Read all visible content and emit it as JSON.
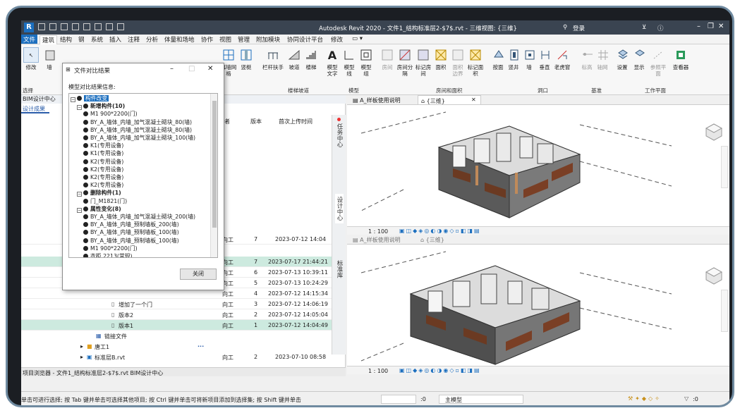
{
  "window": {
    "title": "Autodesk Revit 2020 - 文件1_结构标准层2-$7$.rvt - 三维视图: {三维}",
    "user": "登录",
    "search_icon": "binoculars-icon"
  },
  "menu": [
    "文件",
    "建筑",
    "结构",
    "钢",
    "系统",
    "插入",
    "注释",
    "分析",
    "体量和场地",
    "协作",
    "视图",
    "管理",
    "附加模块",
    "协同设计平台",
    "修改"
  ],
  "ribbon": {
    "tools": [
      "修改",
      "墙",
      "幕墙网格",
      "竖梃",
      "栏杆扶手",
      "坡道",
      "楼梯",
      "模型文字",
      "模型线",
      "模型组",
      "房间",
      "房间分隔",
      "标记房间",
      "面积",
      "面积边界",
      "标记面积",
      "按面",
      "竖井",
      "墙",
      "垂直",
      "老虎窗",
      "标高",
      "轴网",
      "设置",
      "显示",
      "参照平面",
      "查看器"
    ],
    "panels": [
      "选择",
      "楼梯坡道",
      "模型",
      "房间和面积",
      "洞口",
      "基准",
      "工作平面"
    ]
  },
  "left_panel": {
    "header": "BIM设计中心",
    "tab": "设计成果",
    "columns": [
      "作者",
      "版本",
      "首次上传时间"
    ],
    "rows": [
      {
        "name": "",
        "author": "向工",
        "version": "7",
        "time": "2023-07-12 14:04"
      },
      {
        "name": "",
        "author": "向工",
        "version": "7",
        "time": "2023-07-17 21:44:21"
      },
      {
        "name": "",
        "author": "向工",
        "version": "6",
        "time": "2023-07-13 10:39:11"
      },
      {
        "name": "",
        "author": "向工",
        "version": "5",
        "time": "2023-07-13 10:24:29"
      },
      {
        "name": "",
        "author": "向工",
        "version": "4",
        "time": "2023-07-12 14:15:34"
      },
      {
        "name": "增加了一个门",
        "author": "向工",
        "version": "3",
        "time": "2023-07-12 14:06:19"
      },
      {
        "name": "版本2",
        "author": "向工",
        "version": "2",
        "time": "2023-07-12 14:05:04"
      },
      {
        "name": "版本1",
        "author": "向工",
        "version": "1",
        "time": "2023-07-12 14:04:49"
      }
    ],
    "link_file": "链接文件",
    "folder": "唐工1",
    "file": "标准层B.rvt",
    "file_author": "向工",
    "file_version": "2",
    "file_time": "2023-07-10 08:58",
    "side_tabs": [
      "任务中心",
      "设计中心",
      "标准库"
    ],
    "browser_tabs": "项目浏览器 - 文件1_结构标准层2-$7$.rvt   BIM设计中心"
  },
  "dialog": {
    "title": "文件对比结果",
    "info_label": "模型对比结果信息:",
    "close_button": "关闭",
    "tree": [
      {
        "level": 0,
        "text": "构件改变",
        "kind": "root"
      },
      {
        "level": 1,
        "text": "新增构件(10)",
        "kind": "group"
      },
      {
        "level": 2,
        "text": "M1 900*2200(门)"
      },
      {
        "level": 2,
        "text": "BY_A_墙体_内墙_加气混凝土砌块_80(墙)"
      },
      {
        "level": 2,
        "text": "BY_A_墙体_内墙_加气混凝土砌块_80(墙)"
      },
      {
        "level": 2,
        "text": "BY_A_墙体_内墙_加气混凝土砌块_100(墙)"
      },
      {
        "level": 2,
        "text": "K1(专用设备)"
      },
      {
        "level": 2,
        "text": "K1(专用设备)"
      },
      {
        "level": 2,
        "text": "K2(专用设备)"
      },
      {
        "level": 2,
        "text": "K2(专用设备)"
      },
      {
        "level": 2,
        "text": "K2(专用设备)"
      },
      {
        "level": 2,
        "text": "K2(专用设备)"
      },
      {
        "level": 1,
        "text": "删除构件(1)",
        "kind": "group"
      },
      {
        "level": 2,
        "text": "门_M1821(门)"
      },
      {
        "level": 1,
        "text": "属性变化(8)",
        "kind": "group"
      },
      {
        "level": 2,
        "text": "BY_A_墙体_内墙_加气混凝土砌块_200(墙)"
      },
      {
        "level": 2,
        "text": "BY_A_墙体_内墙_预制墙板_200(墙)"
      },
      {
        "level": 2,
        "text": "BY_A_墙体_内墙_预制墙板_100(墙)"
      },
      {
        "level": 2,
        "text": "BY_A_墙体_内墙_预制墙板_100(墙)"
      },
      {
        "level": 2,
        "text": "M1 900*2200(门)"
      },
      {
        "level": 2,
        "text": "衣柜 2213(常规)"
      }
    ]
  },
  "views": {
    "tab1": "A_样板使用说明",
    "tab2": "{三维}",
    "scale": "1 : 100"
  },
  "status": {
    "hint": "单击可进行选择; 按 Tab 键并单击可选择其他项目; 按 Ctrl 键并单击可将新项目添加到选择集; 按 Shift 键并单击",
    "model": "主模型",
    "count": ":0"
  },
  "colors": {
    "accent": "#1c6fbf",
    "selection": "#cdeadf",
    "titlebar": "#3a4451"
  }
}
